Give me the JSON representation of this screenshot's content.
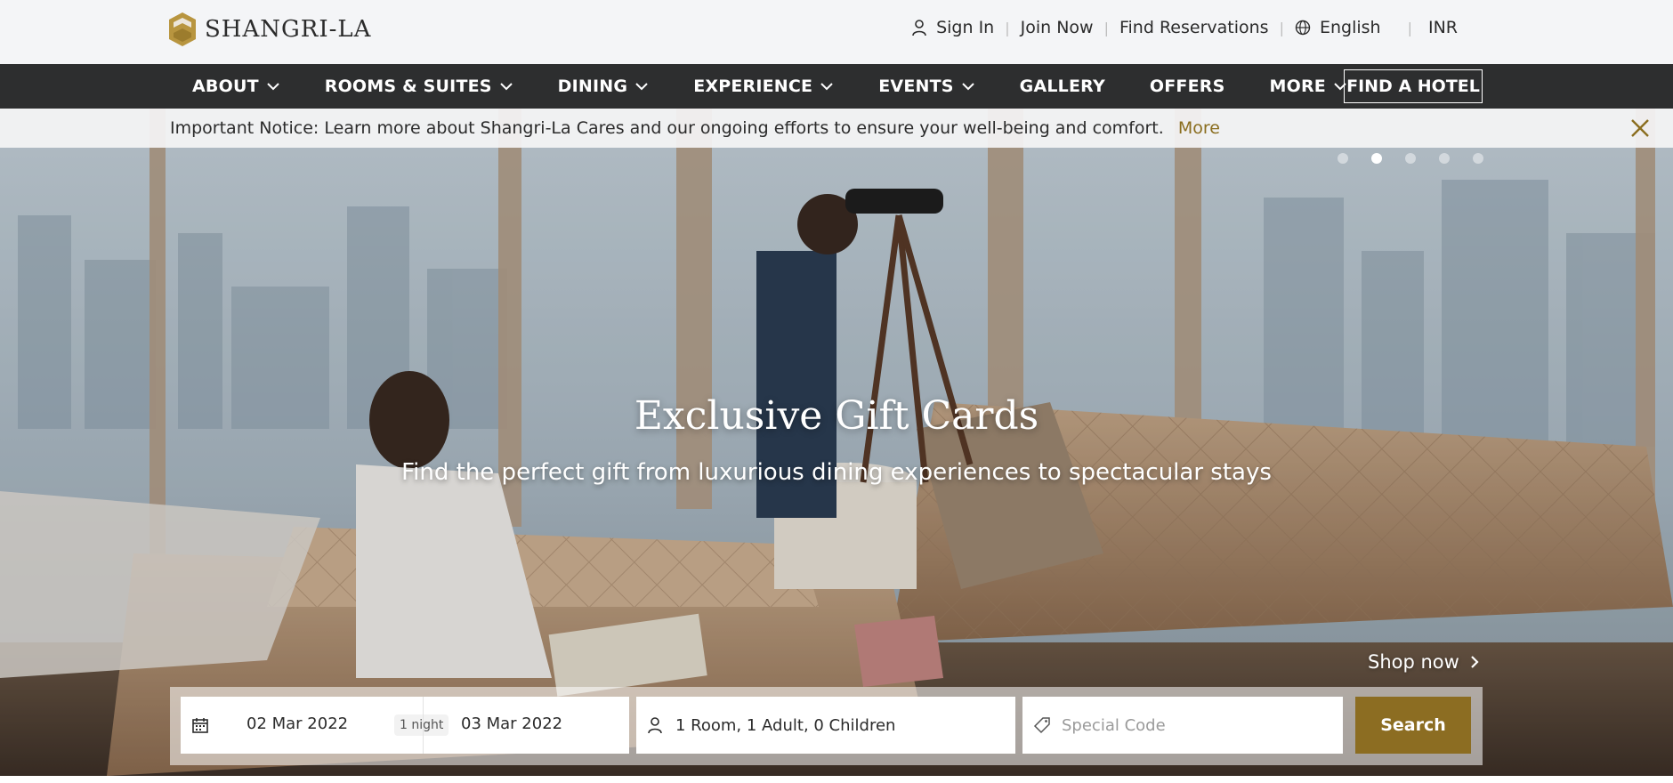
{
  "brand": {
    "name": "SHANGRI-LA"
  },
  "utility_nav": {
    "sign_in": "Sign In",
    "join_now": "Join Now",
    "find_reservations": "Find Reservations",
    "language": "English",
    "currency": "INR"
  },
  "main_nav": {
    "items": [
      {
        "label": "ABOUT",
        "has_dropdown": true
      },
      {
        "label": "ROOMS & SUITES",
        "has_dropdown": true
      },
      {
        "label": "DINING",
        "has_dropdown": true
      },
      {
        "label": "EXPERIENCE",
        "has_dropdown": true
      },
      {
        "label": "EVENTS",
        "has_dropdown": true
      },
      {
        "label": "GALLERY",
        "has_dropdown": false
      },
      {
        "label": "OFFERS",
        "has_dropdown": false
      },
      {
        "label": "MORE",
        "has_dropdown": true
      }
    ],
    "find_hotel": "FIND A HOTEL"
  },
  "notice": {
    "text": "Important Notice: Learn more about Shangri-La Cares and our ongoing efforts to ensure your well-being and comfort.",
    "more_link": "More"
  },
  "hero": {
    "title": "Exclusive Gift Cards",
    "subtitle": "Find the perfect gift from luxurious dining experiences to spectacular stays",
    "cta": "Shop now",
    "slides": 5,
    "active_slide": 2
  },
  "booking": {
    "check_in": "02 Mar 2022",
    "check_out": "03 Mar 2022",
    "nights": "1 night",
    "guests": "1 Room, 1 Adult, 0 Children",
    "special_code_placeholder": "Special Code",
    "search_label": "Search"
  },
  "colors": {
    "accent": "#8c6d22",
    "nav_bg": "#2d2e2f",
    "topbar_bg": "#f4f5f7"
  }
}
